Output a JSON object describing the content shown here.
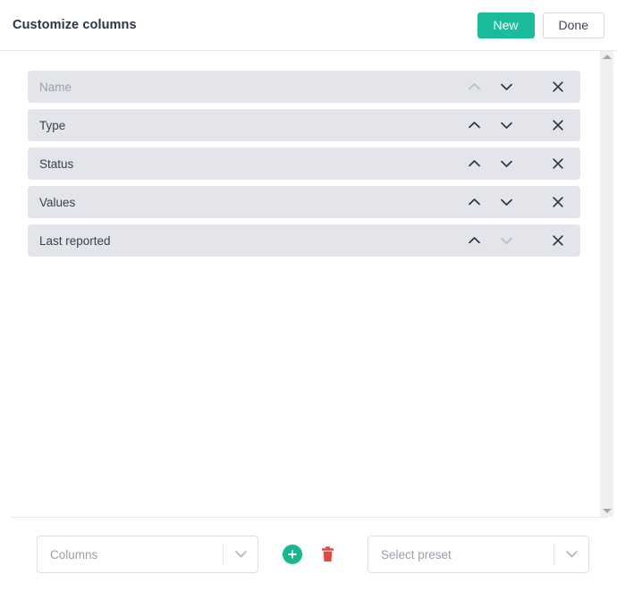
{
  "header": {
    "title": "Customize columns",
    "new_label": "New",
    "done_label": "Done",
    "accent_color": "#1bbc9b"
  },
  "columns_list": {
    "rows": [
      {
        "label": "Name",
        "is_placeholder": true,
        "move_up_enabled": false,
        "move_down_enabled": true
      },
      {
        "label": "Type",
        "is_placeholder": false,
        "move_up_enabled": true,
        "move_down_enabled": true
      },
      {
        "label": "Status",
        "is_placeholder": false,
        "move_up_enabled": true,
        "move_down_enabled": true
      },
      {
        "label": "Values",
        "is_placeholder": false,
        "move_up_enabled": true,
        "move_down_enabled": true
      },
      {
        "label": "Last reported",
        "is_placeholder": false,
        "move_up_enabled": true,
        "move_down_enabled": false
      }
    ]
  },
  "scrollbar": {
    "up_arrow_icon": "triangle-up-icon",
    "down_arrow_icon": "triangle-down-icon"
  },
  "footer": {
    "columns_select": {
      "value": "Columns",
      "icon": "chevron-down-icon"
    },
    "add_button": {
      "icon": "plus-circle-icon",
      "color": "#17b890"
    },
    "delete_button": {
      "icon": "trash-icon",
      "color": "#e04a42"
    },
    "preset_select": {
      "value": "Select preset",
      "icon": "chevron-down-icon"
    }
  }
}
